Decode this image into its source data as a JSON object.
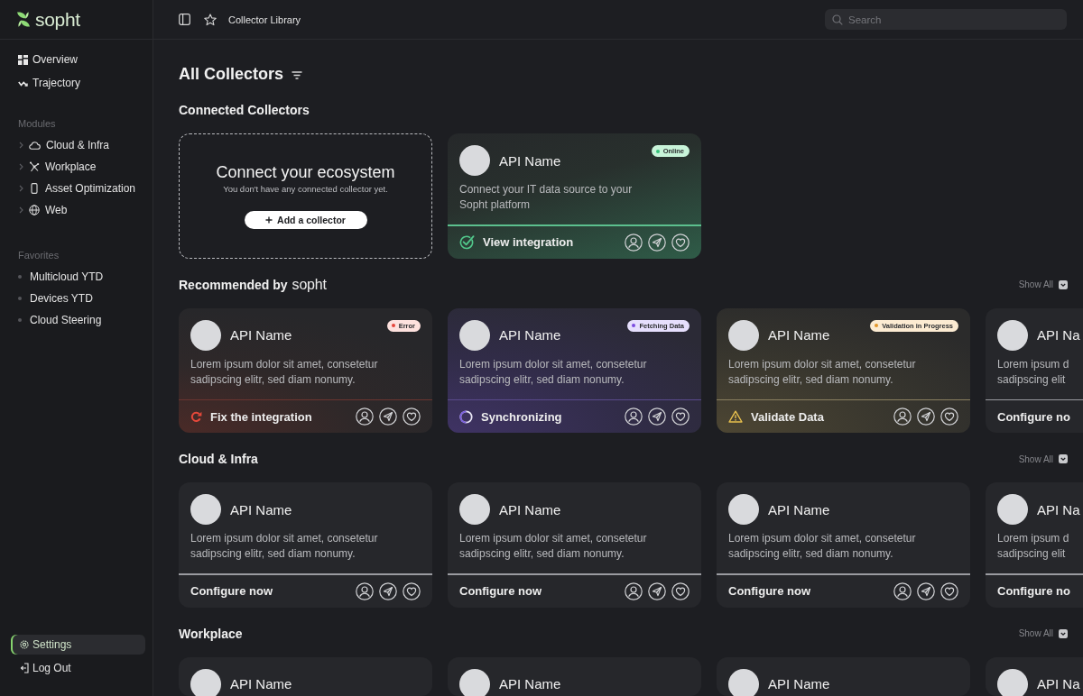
{
  "sidebar": {
    "logo": "sopht",
    "nav": [
      {
        "label": "Overview",
        "selected": false
      },
      {
        "label": "Trajectory",
        "selected": false
      }
    ],
    "modules": {
      "title": "Modules",
      "items": [
        {
          "label": "Cloud & Infra",
          "expanded": false,
          "selected": false
        },
        {
          "label": "Workplace",
          "expanded": false,
          "selected": false
        },
        {
          "label": "Asset Optimization",
          "expanded": false,
          "selected": false
        },
        {
          "label": "Web",
          "expanded": false,
          "selected": false
        }
      ]
    },
    "favorites": {
      "title": "Favorites",
      "items": [
        {
          "label": "Multicloud YTD",
          "selected": false
        },
        {
          "label": "Devices YTD",
          "selected": false
        },
        {
          "label": "Cloud Steering",
          "selected": false
        }
      ]
    },
    "footer": [
      {
        "label": "Settings",
        "selected": true
      },
      {
        "label": "Log Out",
        "selected": false
      }
    ]
  },
  "topbar": {
    "breadcrumb": "Collector Library",
    "search": {
      "placeholder": "Search"
    }
  },
  "page": {
    "title": "All Collectors"
  },
  "sections": [
    {
      "title": "Connected Collectors",
      "empty_prompt": {
        "title": "Connect your ecosystem",
        "text": "You don't have any connected collector yet.",
        "button": "Add a collector"
      },
      "cards": [
        {
          "name": "API Name",
          "kind": "online",
          "badge": {
            "label": "Online",
            "color": "#34c27a"
          },
          "description": "Connect your IT data source to your Sopht platform",
          "action": "View integration",
          "shortcut_icons": true
        }
      ]
    },
    {
      "title": "Recommended by",
      "brand": "sopht",
      "show_all": "Show All",
      "cards": [
        {
          "name": "API Name",
          "kind": "error",
          "badge": {
            "label": "Error",
            "color": "#e5443a"
          },
          "description": "Lorem ipsum dolor sit amet, consetetur sadipscing elitr, sed diam nonumy.",
          "action": "Fix the integration",
          "shortcut_icons": true
        },
        {
          "name": "API Name",
          "kind": "fetching",
          "badge": {
            "label": "Fetching Data",
            "color": "#7b4ce0"
          },
          "description": "Lorem ipsum dolor sit amet, consetetur sadipscing elitr, sed diam nonumy.",
          "action": "Synchronizing",
          "shortcut_icons": true
        },
        {
          "name": "API Name",
          "kind": "validation",
          "badge": {
            "label": "Validation in Progress",
            "color": "#e2962a"
          },
          "description": "Lorem ipsum dolor sit amet, consetetur sadipscing elitr, sed diam nonumy.",
          "action": "Validate Data",
          "shortcut_icons": true
        },
        {
          "name": "API Na",
          "kind": "plain",
          "description": "Lorem ipsum d sadipscing elit",
          "action": "Configure no",
          "shortcut_icons": false
        }
      ]
    },
    {
      "title": "Cloud & Infra",
      "show_all": "Show All",
      "cards": [
        {
          "name": "API Name",
          "kind": "plain",
          "description": "Lorem ipsum dolor sit amet, consetetur sadipscing elitr, sed diam nonumy.",
          "action": "Configure now",
          "shortcut_icons": true
        },
        {
          "name": "API Name",
          "kind": "plain",
          "description": "Lorem ipsum dolor sit amet, consetetur sadipscing elitr, sed diam nonumy.",
          "action": "Configure now",
          "shortcut_icons": true
        },
        {
          "name": "API Name",
          "kind": "plain",
          "description": "Lorem ipsum dolor sit amet, consetetur sadipscing elitr, sed diam nonumy.",
          "action": "Configure now",
          "shortcut_icons": true
        },
        {
          "name": "API Na",
          "kind": "plain",
          "description": "Lorem ipsum d sadipscing elit",
          "action": "Configure no",
          "shortcut_icons": false
        }
      ]
    },
    {
      "title": "Workplace",
      "show_all": "Show All",
      "cards": [
        {
          "name": "API Name",
          "kind": "plain"
        },
        {
          "name": "API Name",
          "kind": "plain"
        },
        {
          "name": "API Name",
          "kind": "plain"
        },
        {
          "name": "API Na",
          "kind": "plain"
        }
      ]
    }
  ]
}
